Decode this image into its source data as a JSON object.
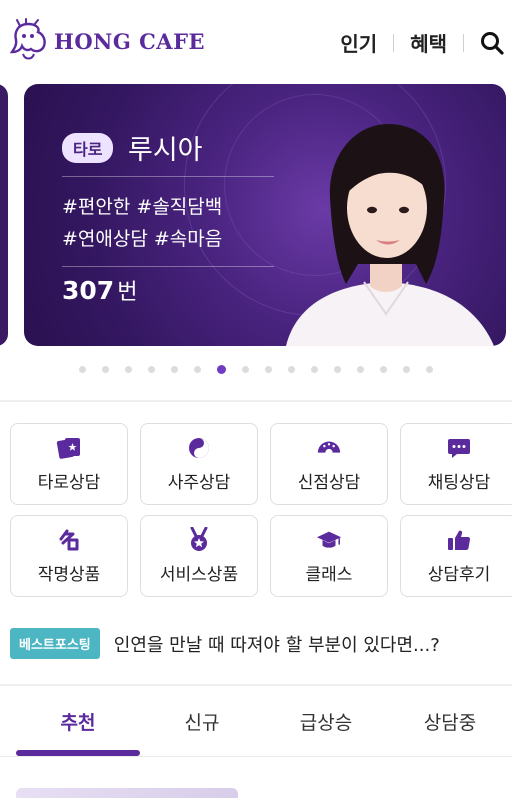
{
  "header": {
    "brand": "HONG CAFE",
    "nav": [
      "인기",
      "혜택"
    ]
  },
  "banner": {
    "tag": "타로",
    "name": "루시아",
    "hashtags_line1": "#편안한  #솔직담백",
    "hashtags_line2": "#연애상담  #속마음",
    "number": "307",
    "number_unit": "번",
    "dots_total": 16,
    "dots_active_index": 6
  },
  "menu": [
    {
      "label": "타로상담",
      "icon": "tarot-card-icon"
    },
    {
      "label": "사주상담",
      "icon": "yin-yang-icon"
    },
    {
      "label": "신점상담",
      "icon": "fan-icon"
    },
    {
      "label": "채팅상담",
      "icon": "chat-bubble-icon"
    },
    {
      "label": "작명상품",
      "icon": "name-character-icon"
    },
    {
      "label": "서비스상품",
      "icon": "medal-icon"
    },
    {
      "label": "클래스",
      "icon": "graduation-cap-icon"
    },
    {
      "label": "상담후기",
      "icon": "thumbs-up-icon"
    }
  ],
  "best_posting": {
    "badge": "베스트포스팅",
    "text": "인연을 만날 때 따져야 할 부분이 있다면...?"
  },
  "tabs": [
    "추천",
    "신규",
    "급상승",
    "상담중"
  ],
  "active_tab": 0,
  "colors": {
    "brand": "#5b2a9d",
    "badge_teal": "#4cb6c2",
    "banner_bg": "#341761"
  }
}
